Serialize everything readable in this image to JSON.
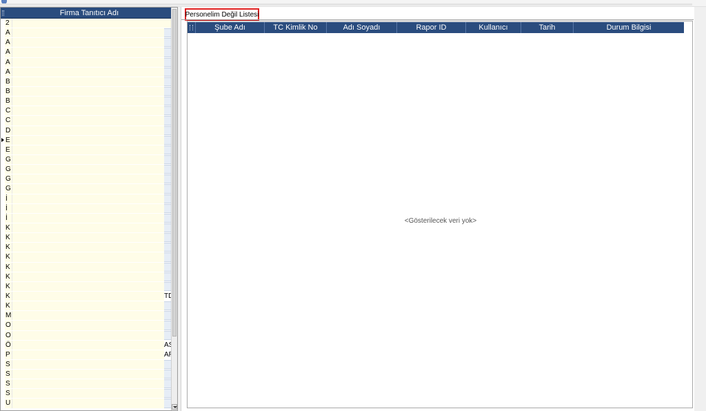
{
  "left_grid": {
    "header": "Firma Tanıtıcı Adı",
    "rows": [
      {
        "letter": "2",
        "end": ""
      },
      {
        "letter": "A",
        "end": ""
      },
      {
        "letter": "A",
        "end": ""
      },
      {
        "letter": "A",
        "end": ""
      },
      {
        "letter": "A",
        "end": ""
      },
      {
        "letter": "A",
        "end": ""
      },
      {
        "letter": "B",
        "end": ""
      },
      {
        "letter": "B",
        "end": ""
      },
      {
        "letter": "B",
        "end": ""
      },
      {
        "letter": "C",
        "end": ""
      },
      {
        "letter": "C",
        "end": ""
      },
      {
        "letter": "D",
        "end": ""
      },
      {
        "letter": "E",
        "end": ""
      },
      {
        "letter": "E",
        "end": ""
      },
      {
        "letter": "G",
        "end": ""
      },
      {
        "letter": "G",
        "end": ""
      },
      {
        "letter": "G",
        "end": ""
      },
      {
        "letter": "G",
        "end": ""
      },
      {
        "letter": "İ",
        "end": ""
      },
      {
        "letter": "İ",
        "end": ""
      },
      {
        "letter": "İ",
        "end": ""
      },
      {
        "letter": "K",
        "end": ""
      },
      {
        "letter": "K",
        "end": ""
      },
      {
        "letter": "K",
        "end": ""
      },
      {
        "letter": "K",
        "end": ""
      },
      {
        "letter": "K",
        "end": ""
      },
      {
        "letter": "K",
        "end": ""
      },
      {
        "letter": "K",
        "end": ""
      },
      {
        "letter": "K",
        "end": "TD"
      },
      {
        "letter": "K",
        "end": ""
      },
      {
        "letter": "M",
        "end": ""
      },
      {
        "letter": "O",
        "end": ""
      },
      {
        "letter": "O",
        "end": ""
      },
      {
        "letter": "Ö",
        "end": "AS"
      },
      {
        "letter": "P",
        "end": "AR"
      },
      {
        "letter": "S",
        "end": ""
      },
      {
        "letter": "S",
        "end": ""
      },
      {
        "letter": "S",
        "end": ""
      },
      {
        "letter": "S",
        "end": ""
      },
      {
        "letter": "U",
        "end": ""
      }
    ]
  },
  "right_panel": {
    "tab_label": "Personelim Değil Listesi",
    "columns": [
      "Şube Adı",
      "TC Kimlik No",
      "Adı Soyadı",
      "Rapor ID",
      "Kullanıcı",
      "Tarih",
      "Durum Bilgisi"
    ],
    "empty_message": "<Gösterilecek veri yok>"
  },
  "colors": {
    "header_bg": "#2a4c7e",
    "row_bg": "#fffde8",
    "tab_highlight": "#e02020"
  }
}
